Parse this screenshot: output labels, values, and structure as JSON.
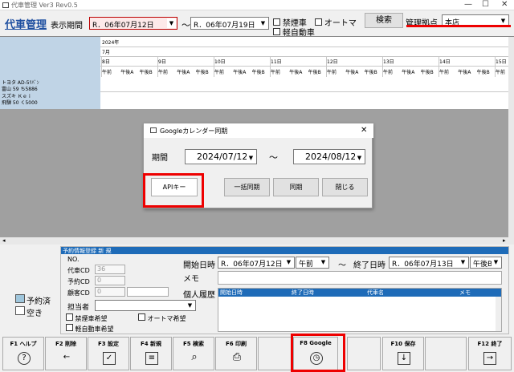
{
  "window": {
    "title": "代車管理 Ver3 Rev0.5",
    "min": "—",
    "max": "☐",
    "close": "✕"
  },
  "header": {
    "app_title": "代車管理",
    "period_label": "表示期間",
    "from_date": "R．06年07月12日",
    "tilde": "～",
    "to_date": "R．06年07月19日",
    "chk_kinen": "禁煙車",
    "chk_auto": "オートマ",
    "chk_kei": "軽自動車",
    "search_button": "検索",
    "base_label": "管理拠点",
    "base_value": "本店"
  },
  "schedule": {
    "year": "2024年",
    "month": "7月",
    "days": [
      "8日",
      "9日",
      "10日",
      "11日",
      "12日",
      "13日",
      "14日",
      "15日"
    ],
    "slots": [
      "午前",
      "午後A",
      "午後B"
    ],
    "cars": [
      {
        "name": "トヨタ AD-5ﾘﾊﾞﾝ",
        "plate": "富山 59 ち5886"
      },
      {
        "name": "スズキ Ｋｅｉ",
        "plate": "飛騨 50 く5000"
      }
    ]
  },
  "dialog": {
    "title": "Googleカレンダー同期",
    "period_label": "期間",
    "from": "2024/07/12",
    "tilde": "～",
    "to": "2024/08/12",
    "api_button": "APIキー",
    "bulk_button": "一括同期",
    "sync_button": "同期",
    "close_button": "閉じる",
    "close_x": "✕"
  },
  "reservation": {
    "title": "予約情報登録 新 規",
    "no_label": "NO.",
    "daisha_cd_label": "代車CD",
    "daisha_cd_value": "36",
    "yoyaku_cd_label": "予約CD",
    "yoyaku_cd_value": "0",
    "kokyaku_cd_label": "顧客CD",
    "kokyaku_cd_value": "0",
    "tantou_label": "担当者",
    "chk_kinen": "禁煙車希望",
    "chk_auto": "オートマ希望",
    "chk_kei": "軽自動車希望",
    "start_label": "開始日時",
    "start_date": "R．06年07月12日",
    "start_time": "午前",
    "tilde": "～",
    "end_label": "終了日時",
    "end_date": "R．06年07月13日",
    "end_time": "午後B",
    "memo_label": "メモ",
    "history_label": "個人履歴",
    "history_cols": [
      "開始日時",
      "終了日時",
      "代車名",
      "メモ"
    ]
  },
  "legend": {
    "reserved": "予約済",
    "free": "空き"
  },
  "fkeys": [
    {
      "label": "F1 ヘルプ",
      "icon": "help-icon",
      "glyph": "?"
    },
    {
      "label": "F2 削除",
      "icon": "delete-icon",
      "glyph": "←"
    },
    {
      "label": "F3 設定",
      "icon": "settings-icon",
      "glyph": "✓"
    },
    {
      "label": "F4 新規",
      "icon": "new-icon",
      "glyph": "≡"
    },
    {
      "label": "F5 検索",
      "icon": "search-icon",
      "glyph": "⌕"
    },
    {
      "label": "F6 印刷",
      "icon": "print-icon",
      "glyph": "⎙"
    },
    {
      "label": "F8 Google",
      "icon": "clock-icon",
      "glyph": "◷"
    },
    {
      "label": "F10 保存",
      "icon": "save-icon",
      "glyph": "↓"
    },
    {
      "label": "F12 終了",
      "icon": "exit-icon",
      "glyph": "→"
    }
  ],
  "colors": {
    "accent_red": "#e00000",
    "header_blue": "#1e6bb8",
    "reserved": "#9fc6dc",
    "grid_bg": "#a0a0a0"
  }
}
